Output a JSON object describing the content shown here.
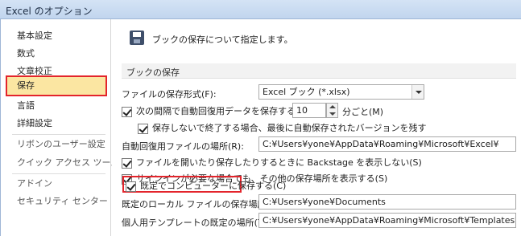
{
  "window": {
    "title": "Excel のオプション"
  },
  "sidebar": {
    "items": [
      {
        "label": "基本設定"
      },
      {
        "label": "数式"
      },
      {
        "label": "文章校正"
      },
      {
        "label": "保存"
      },
      {
        "label": "言語"
      },
      {
        "label": "詳細設定"
      },
      {
        "label": "リボンのユーザー設定"
      },
      {
        "label": "クイック アクセス ツール バー"
      },
      {
        "label": "アドイン"
      },
      {
        "label": "セキュリティ センター"
      }
    ]
  },
  "main": {
    "header": "ブックの保存について指定します。",
    "section_title": "ブックの保存",
    "file_format_label": "ファイルの保存形式(F):",
    "file_format_value": "Excel ブック (*.xlsx)",
    "autorecover_label": "次の間隔で自動回復用データを保存する(A):",
    "autorecover_minutes": "10",
    "minutes_unit": "分ごと(M)",
    "keep_last_label": "保存しないで終了する場合、最後に自動保存されたバージョンを残す",
    "autorecover_location_label": "自動回復用ファイルの場所(R):",
    "autorecover_location_value": "C:¥Users¥yone¥AppData¥Roaming¥Microsoft¥Excel¥",
    "backstage_label": "ファイルを開いたり保存したりするときに Backstage を表示しない(S)",
    "signin_label": "サインインが必要な場合でも、その他の保存場所を表示する(S)",
    "default_computer_label": "既定でコンピューターに保存する(C)",
    "local_location_label": "既定のローカル ファイルの保存場所(I):",
    "local_location_value": "C:¥Users¥yone¥Documents",
    "template_location_label": "個人用テンプレートの既定の場所(T):",
    "template_location_value": "C:¥Users¥yone¥AppData¥Roaming¥Microsoft¥Templates¥"
  },
  "colors": {
    "selected_bg": "#fbe6a2",
    "highlight_red": "#e3242b",
    "title_bg": "#c9d9ee"
  },
  "icons": {
    "header": "floppy-disk-icon",
    "dropdown": "chevron-down-icon"
  }
}
